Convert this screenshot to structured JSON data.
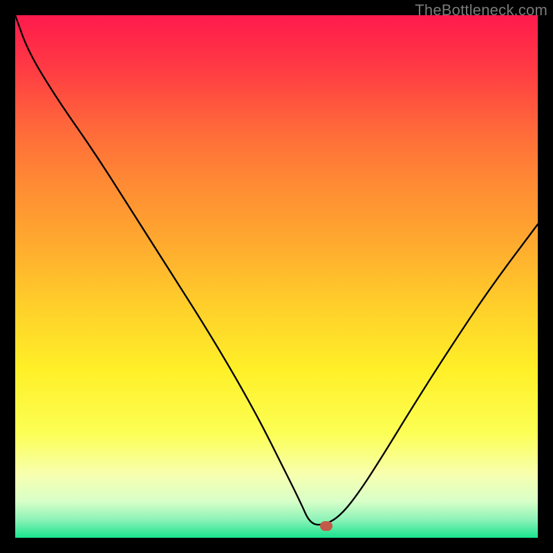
{
  "watermark": "TheBottleneck.com",
  "chart_data": {
    "type": "line",
    "title": "",
    "xlabel": "",
    "ylabel": "",
    "x_range_norm": [
      0,
      1
    ],
    "y_range_norm": [
      0,
      1
    ],
    "y_axis_inverted": true,
    "note": "Normalized V-shaped bottleneck curve. Lower y = better (green). Minimum around x≈0.58.",
    "series": [
      {
        "name": "bottleneck-curve",
        "x": [
          0.0,
          0.025,
          0.08,
          0.15,
          0.22,
          0.29,
          0.36,
          0.42,
          0.47,
          0.51,
          0.545,
          0.565,
          0.595,
          0.625,
          0.66,
          0.705,
          0.76,
          0.83,
          0.91,
          1.0
        ],
        "y": [
          0.0,
          0.07,
          0.16,
          0.26,
          0.37,
          0.48,
          0.59,
          0.69,
          0.78,
          0.86,
          0.93,
          0.975,
          0.975,
          0.955,
          0.91,
          0.84,
          0.75,
          0.64,
          0.52,
          0.4
        ]
      }
    ],
    "marker": {
      "x_norm": 0.595,
      "y_norm": 0.978
    },
    "gradient_stops": [
      {
        "pos": 0.0,
        "color": "#ff1a4d"
      },
      {
        "pos": 0.5,
        "color": "#ffd02a"
      },
      {
        "pos": 0.85,
        "color": "#fcff55"
      },
      {
        "pos": 1.0,
        "color": "#18e38e"
      }
    ]
  }
}
